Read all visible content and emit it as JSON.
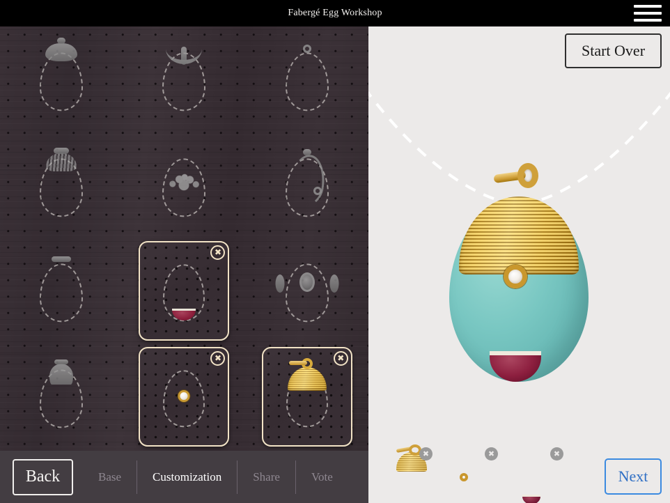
{
  "header": {
    "title": "Fabergé Egg Workshop",
    "menu_icon": "hamburger-menu-icon"
  },
  "right_panel": {
    "start_over_label": "Start Over",
    "next_label": "Next",
    "background_color": "#eceae9",
    "chain_style": "dashed-white-necklace"
  },
  "bottom_nav": {
    "back_label": "Back",
    "steps": [
      {
        "label": "Base",
        "active": false
      },
      {
        "label": "Customization",
        "active": true
      },
      {
        "label": "Share",
        "active": false
      },
      {
        "label": "Vote",
        "active": false
      }
    ]
  },
  "workbench": {
    "background": "dark-wood-pegboard",
    "columns": 3,
    "rows": 4,
    "remove_badge_glyph": "✖",
    "tiles": [
      {
        "id": "tile-1",
        "ornament": "petal-crown",
        "selected": false
      },
      {
        "id": "tile-2",
        "ornament": "ribbon-swag",
        "selected": false
      },
      {
        "id": "tile-3",
        "ornament": "small-loop-top",
        "selected": false
      },
      {
        "id": "tile-4",
        "ornament": "fan-cap",
        "selected": false
      },
      {
        "id": "tile-5",
        "ornament": "floral-spray",
        "selected": false
      },
      {
        "id": "tile-6",
        "ornament": "scroll-ribbon",
        "selected": false
      },
      {
        "id": "tile-7",
        "ornament": "plain-bar-top",
        "selected": false
      },
      {
        "id": "tile-8",
        "ornament": "ruby-cabochon-base",
        "selected": true
      },
      {
        "id": "tile-9",
        "ornament": "oval-boss-sides",
        "selected": false
      },
      {
        "id": "tile-10",
        "ornament": "twin-petal-top",
        "selected": false
      },
      {
        "id": "tile-11",
        "ornament": "pearl-cabochon",
        "selected": true
      },
      {
        "id": "tile-12",
        "ornament": "gold-ribbed-dome",
        "selected": true
      }
    ]
  },
  "preview": {
    "pendant_name": "turquoise-faberge-egg-pendant",
    "parts": [
      {
        "name": "gold-bail",
        "color": "#cfa03a"
      },
      {
        "name": "gold-ribbed-dome-cap",
        "color": "#dcb23f"
      },
      {
        "name": "turquoise-egg-body",
        "color": "#79c7c2"
      },
      {
        "name": "pearl-cabochon",
        "color": "#f4f0ea"
      },
      {
        "name": "ruby-cabochon",
        "color": "#8d1f3f"
      }
    ]
  },
  "tray": {
    "items": [
      {
        "name": "gold-ribbed-dome",
        "badge": "✖"
      },
      {
        "name": "pearl-cabochon",
        "badge": "✖"
      },
      {
        "name": "ruby-cabochon",
        "badge": "✖"
      }
    ]
  }
}
